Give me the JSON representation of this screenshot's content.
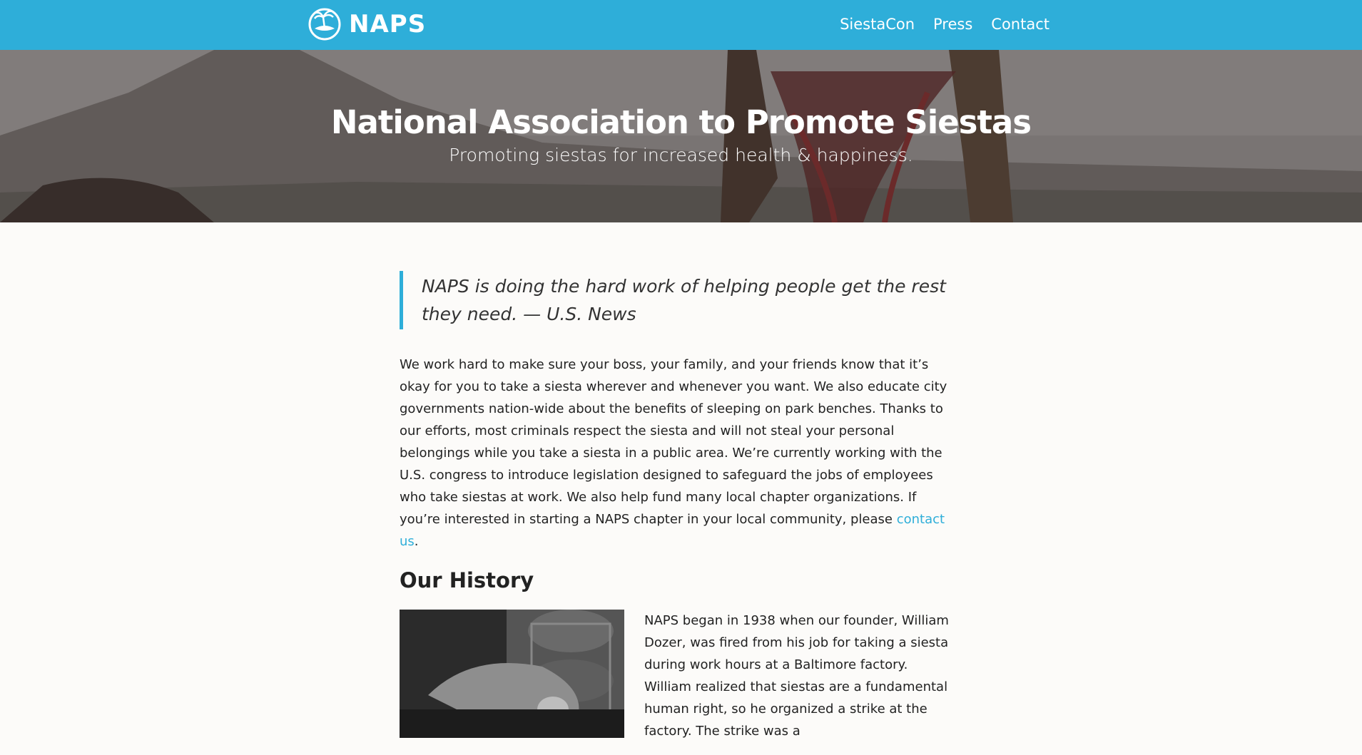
{
  "header": {
    "logo_text": "NAPS",
    "nav": [
      "SiestaCon",
      "Press",
      "Contact"
    ]
  },
  "hero": {
    "title": "National Association to Promote Siestas",
    "subtitle": "Promoting siestas for increased health & happiness."
  },
  "quote": {
    "text": "NAPS is doing the hard work of helping people get the rest they need. — U.S. News"
  },
  "intro": {
    "text": "We work hard to make sure your boss, your family, and your friends know that it’s okay for you to take a siesta wherever and whenever you want. We also educate city governments nation-wide about the benefits of sleeping on park benches. Thanks to our efforts, most criminals respect the siesta and will not steal your personal belongings while you take a siesta in a public area. We’re currently working with the U.S. congress to introduce legislation designed to safeguard the jobs of employees who take siestas at work. We also help fund many local chapter organizations. If you’re interested in starting a NAPS chapter in your local community, please ",
    "link": "contact us",
    "after_link": "."
  },
  "history": {
    "heading": "Our History",
    "text": "NAPS began in 1938 when our founder, William Dozer, was fired from his job for taking a siesta during work hours at a Baltimore factory. William realized that siestas are a fundamental human right, so he organized a strike at the factory. The strike was a"
  },
  "colors": {
    "brand": "#2eaed9",
    "background": "#fcfbf9"
  }
}
